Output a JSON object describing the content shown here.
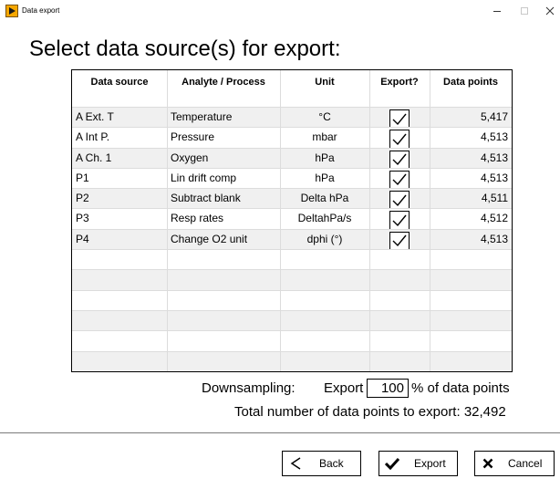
{
  "window": {
    "title": "Data export",
    "icon": "play-triangle-icon",
    "controls": [
      "minimize",
      "maximize",
      "close"
    ]
  },
  "heading": "Select data source(s) for export:",
  "table": {
    "columns": [
      "Data source",
      "Analyte / Process",
      "Unit",
      "Export?",
      "Data points"
    ],
    "rows": [
      {
        "source": "A Ext. T",
        "analyte": "Temperature",
        "unit": "°C",
        "export": true,
        "points": "5,417"
      },
      {
        "source": "A Int P.",
        "analyte": "Pressure",
        "unit": "mbar",
        "export": true,
        "points": "4,513"
      },
      {
        "source": "A Ch. 1",
        "analyte": "Oxygen",
        "unit": "hPa",
        "export": true,
        "points": "4,513"
      },
      {
        "source": "P1",
        "analyte": "Lin drift comp",
        "unit": "hPa",
        "export": true,
        "points": "4,513"
      },
      {
        "source": "P2",
        "analyte": "Subtract blank",
        "unit": "Delta hPa",
        "export": true,
        "points": "4,511"
      },
      {
        "source": "P3",
        "analyte": "Resp rates",
        "unit": "DeltahPa/s",
        "export": true,
        "points": "4,512"
      },
      {
        "source": "P4",
        "analyte": "Change O2 unit",
        "unit": "dphi (°)",
        "export": true,
        "points": "4,513"
      },
      {
        "source": "",
        "analyte": "",
        "unit": "",
        "export": false,
        "points": ""
      },
      {
        "source": "",
        "analyte": "",
        "unit": "",
        "export": false,
        "points": ""
      },
      {
        "source": "",
        "analyte": "",
        "unit": "",
        "export": false,
        "points": ""
      },
      {
        "source": "",
        "analyte": "",
        "unit": "",
        "export": false,
        "points": ""
      },
      {
        "source": "",
        "analyte": "",
        "unit": "",
        "export": false,
        "points": ""
      },
      {
        "source": "",
        "analyte": "",
        "unit": "",
        "export": false,
        "points": ""
      }
    ]
  },
  "downsampling": {
    "label": "Downsampling:",
    "export_label": "Export",
    "percent_value": "100",
    "percent_suffix": "% of data points"
  },
  "total_text": "Total number of data points to export: 32,492",
  "buttons": {
    "back": "Back",
    "export": "Export",
    "cancel": "Cancel"
  },
  "colors": {
    "app_icon_fill": "#f5a700",
    "shaded_row": "#f0f0f0",
    "gridline": "#dcdcdc"
  }
}
